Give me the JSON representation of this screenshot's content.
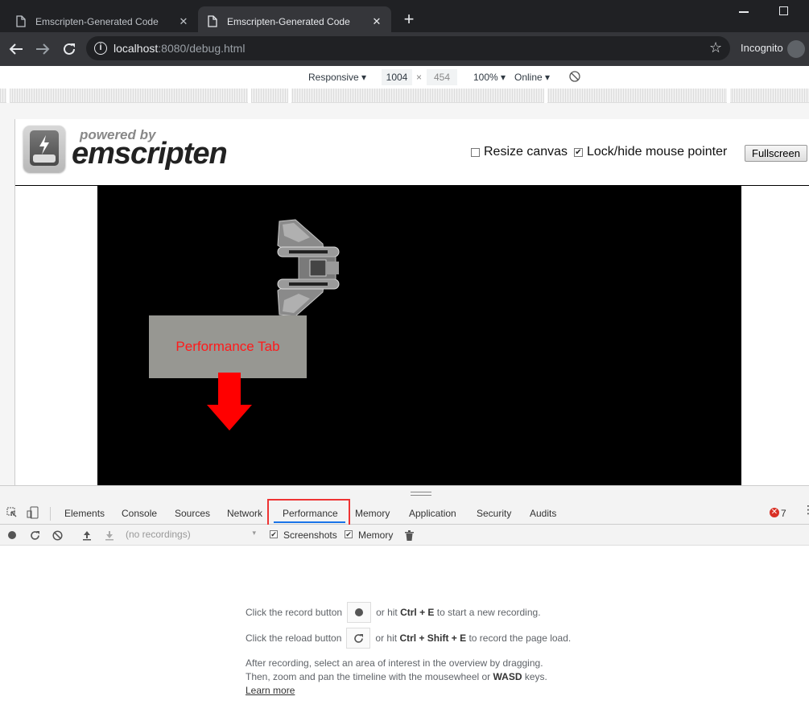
{
  "browser": {
    "tabs": [
      {
        "title": "Emscripten-Generated Code",
        "active": false
      },
      {
        "title": "Emscripten-Generated Code",
        "active": true
      }
    ],
    "new_tab_icon": "+",
    "url_host": "localhost",
    "url_rest": ":8080/debug.html",
    "incognito_label": "Incognito",
    "icons": [
      "back-arrow-icon",
      "forward-arrow-icon",
      "reload-icon",
      "info-icon",
      "star-icon",
      "incognito-icon"
    ]
  },
  "device_toolbar": {
    "mode": "Responsive",
    "width": "1004",
    "times": "×",
    "height": "454",
    "zoom": "100%",
    "network": "Online"
  },
  "page": {
    "logo_tagline": "powered by",
    "logo_name": "emscripten",
    "resize_canvas_label": "Resize canvas",
    "resize_canvas_checked": false,
    "lock_pointer_label": "Lock/hide mouse pointer",
    "lock_pointer_checked": true,
    "fullscreen_label": "Fullscreen",
    "callout_text": "Performance Tab",
    "callout_color": "#ff1a1a"
  },
  "devtools": {
    "tabs": [
      "Elements",
      "Console",
      "Sources",
      "Network",
      "Performance",
      "Memory",
      "Application",
      "Security",
      "Audits"
    ],
    "selected_tab": "Performance",
    "error_count": "7",
    "recordings_placeholder": "(no recordings)",
    "screenshots_label": "Screenshots",
    "screenshots_checked": true,
    "memory_label": "Memory",
    "memory_checked": true
  },
  "landing": {
    "record_before": "Click the record button",
    "record_after_1": "or hit",
    "record_keys": "Ctrl + E",
    "record_after_2": "to start a new recording.",
    "reload_before": "Click the reload button",
    "reload_after_1": "or hit",
    "reload_keys": "Ctrl + Shift + E",
    "reload_after_2": "to record the page load.",
    "para_line1": "After recording, select an area of interest in the overview by dragging.",
    "para_line2_a": "Then, zoom and pan the timeline with the mousewheel or",
    "para_line2_keys": "WASD",
    "para_line2_b": "keys.",
    "learn_more": "Learn more"
  }
}
